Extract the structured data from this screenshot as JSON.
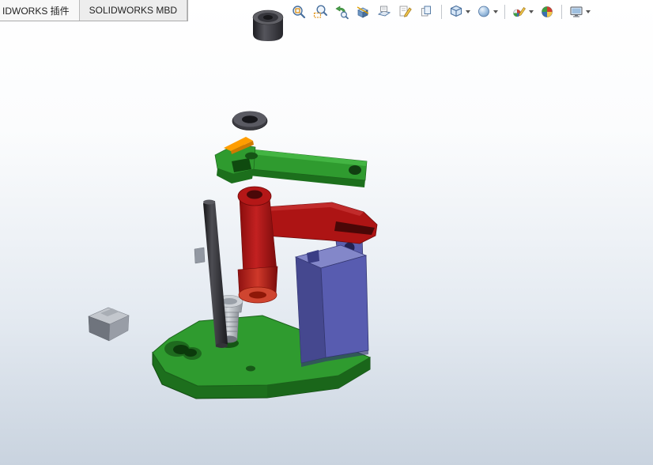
{
  "tabs": [
    {
      "label": "IDWORKS 插件"
    },
    {
      "label": "SOLIDWORKS MBD"
    }
  ],
  "toolbar": {
    "groups": [
      {
        "name": "view-tools",
        "icons": [
          "zoom-to-fit",
          "zoom-to-area",
          "previous-view",
          "section-view",
          "3d-drawing-view",
          "annotations",
          "copy-settings"
        ]
      },
      {
        "name": "orientation-display",
        "icons": [
          "view-orientation",
          "display-style"
        ]
      },
      {
        "name": "appearance",
        "icons": [
          "edit-appearance",
          "apply-scene"
        ]
      },
      {
        "name": "settings",
        "icons": [
          "view-settings"
        ]
      }
    ]
  },
  "viewport": {
    "scene": "exploded-view-assembly",
    "background_top": "#ffffff",
    "background_bottom": "#c9d3df",
    "parts": [
      {
        "name": "knob-cap",
        "color": "#3a3a40"
      },
      {
        "name": "washer",
        "color": "#4c4c53"
      },
      {
        "name": "lever-arm",
        "color": "#2f9b2f",
        "accent_color": "#ff9d00"
      },
      {
        "name": "link-arm",
        "color": "#b41717"
      },
      {
        "name": "pivot-rod",
        "color": "#26262a"
      },
      {
        "name": "slide-block",
        "color": "#585cb0"
      },
      {
        "name": "threaded-stud",
        "color": "#a8adb5"
      },
      {
        "name": "jaw-block",
        "color": "#989da6"
      },
      {
        "name": "base-plate",
        "color": "#2f9b2f"
      }
    ]
  }
}
